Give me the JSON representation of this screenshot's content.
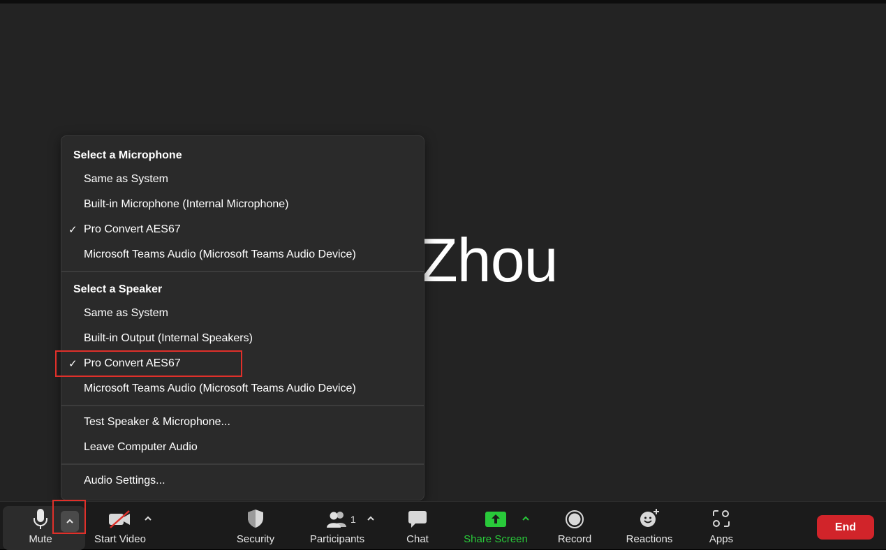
{
  "participant": {
    "display_name": "Zhou"
  },
  "menu": {
    "mic_header": "Select a Microphone",
    "mic_items": [
      {
        "label": "Same as System",
        "checked": false
      },
      {
        "label": "Built-in Microphone (Internal Microphone)",
        "checked": false
      },
      {
        "label": "Pro Convert AES67",
        "checked": true
      },
      {
        "label": "Microsoft Teams Audio (Microsoft Teams Audio Device)",
        "checked": false
      }
    ],
    "speaker_header": "Select a Speaker",
    "speaker_items": [
      {
        "label": "Same as System",
        "checked": false
      },
      {
        "label": "Built-in Output (Internal Speakers)",
        "checked": false
      },
      {
        "label": "Pro Convert AES67",
        "checked": true
      },
      {
        "label": "Microsoft Teams Audio (Microsoft Teams Audio Device)",
        "checked": false
      }
    ],
    "test_label": "Test Speaker & Microphone...",
    "leave_label": "Leave Computer Audio",
    "settings_label": "Audio Settings...",
    "check_glyph": "✓"
  },
  "toolbar": {
    "mute_label": "Mute",
    "video_label": "Start Video",
    "security_label": "Security",
    "participants_label": "Participants",
    "participants_count": "1",
    "chat_label": "Chat",
    "share_label": "Share Screen",
    "record_label": "Record",
    "reactions_label": "Reactions",
    "apps_label": "Apps",
    "end_label": "End",
    "caret_glyph": "^"
  },
  "colors": {
    "accent_green": "#29c93a",
    "end_red": "#d1242a",
    "highlight_red": "#e0302a"
  }
}
